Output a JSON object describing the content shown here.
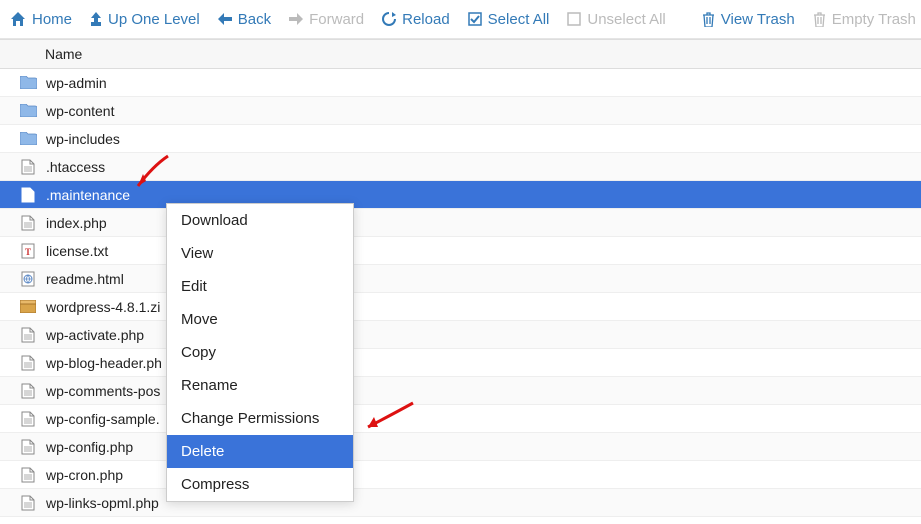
{
  "toolbar": {
    "home": "Home",
    "up": "Up One Level",
    "back": "Back",
    "forward": "Forward",
    "reload": "Reload",
    "select_all": "Select All",
    "unselect_all": "Unselect All",
    "view_trash": "View Trash",
    "empty_trash": "Empty Trash"
  },
  "columns": {
    "name": "Name"
  },
  "files": [
    {
      "name": "wp-admin",
      "type": "folder"
    },
    {
      "name": "wp-content",
      "type": "folder"
    },
    {
      "name": "wp-includes",
      "type": "folder"
    },
    {
      "name": ".htaccess",
      "type": "file"
    },
    {
      "name": ".maintenance",
      "type": "file",
      "selected": true
    },
    {
      "name": "index.php",
      "type": "file"
    },
    {
      "name": "license.txt",
      "type": "txt"
    },
    {
      "name": "readme.html",
      "type": "html"
    },
    {
      "name": "wordpress-4.8.1.zi",
      "type": "zip"
    },
    {
      "name": "wp-activate.php",
      "type": "file"
    },
    {
      "name": "wp-blog-header.ph",
      "type": "file"
    },
    {
      "name": "wp-comments-pos",
      "type": "file"
    },
    {
      "name": "wp-config-sample.",
      "type": "file"
    },
    {
      "name": "wp-config.php",
      "type": "file"
    },
    {
      "name": "wp-cron.php",
      "type": "file"
    },
    {
      "name": "wp-links-opml.php",
      "type": "file"
    }
  ],
  "context_menu": {
    "items": [
      {
        "label": "Download"
      },
      {
        "label": "View"
      },
      {
        "label": "Edit"
      },
      {
        "label": "Move"
      },
      {
        "label": "Copy"
      },
      {
        "label": "Rename"
      },
      {
        "label": "Change Permissions"
      },
      {
        "label": "Delete",
        "highlight": true
      },
      {
        "label": "Compress"
      }
    ]
  },
  "icons": {
    "home": "home-icon",
    "up": "up-icon",
    "back": "back-icon",
    "forward": "forward-icon",
    "reload": "reload-icon",
    "select_all": "select-all-icon",
    "unselect_all": "unselect-all-icon",
    "trash": "trash-icon"
  }
}
